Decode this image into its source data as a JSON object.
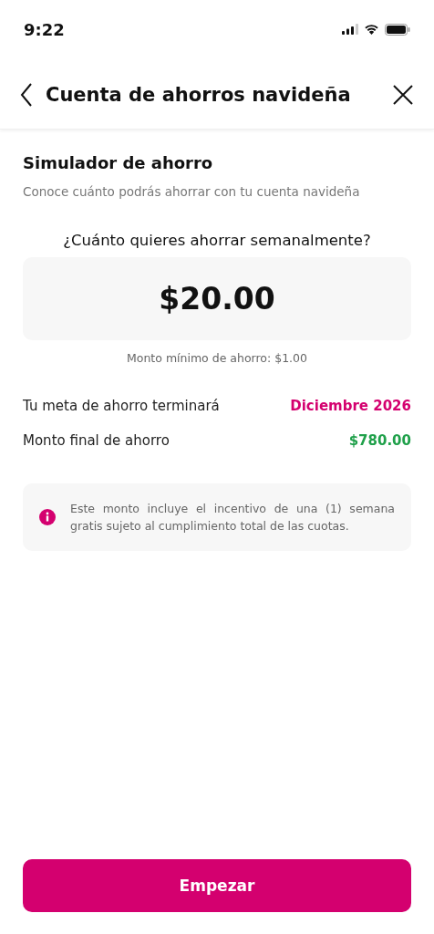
{
  "status_bar": {
    "time": "9:22"
  },
  "header": {
    "title": "Cuenta de ahorros navideña"
  },
  "section": {
    "title": "Simulador de ahorro",
    "subtitle": "Conoce cuánto podrás ahorrar con tu cuenta navideña"
  },
  "amount": {
    "question": "¿Cuánto quieres ahorrar semanalmente?",
    "value": "$20.00",
    "hint": "Monto mínimo de ahorro: $1.00"
  },
  "results": [
    {
      "label": "Tu meta de ahorro terminará",
      "value": "Diciembre 2026",
      "color": "#d4006f"
    },
    {
      "label": "Monto final de ahorro",
      "value": "$780.00",
      "color": "#1fa04a"
    }
  ],
  "notice": {
    "text": "Este monto incluye el incentivo de una (1) semana gratis sujeto al cumplimiento total de las cuotas."
  },
  "button": {
    "label": "Empezar"
  }
}
